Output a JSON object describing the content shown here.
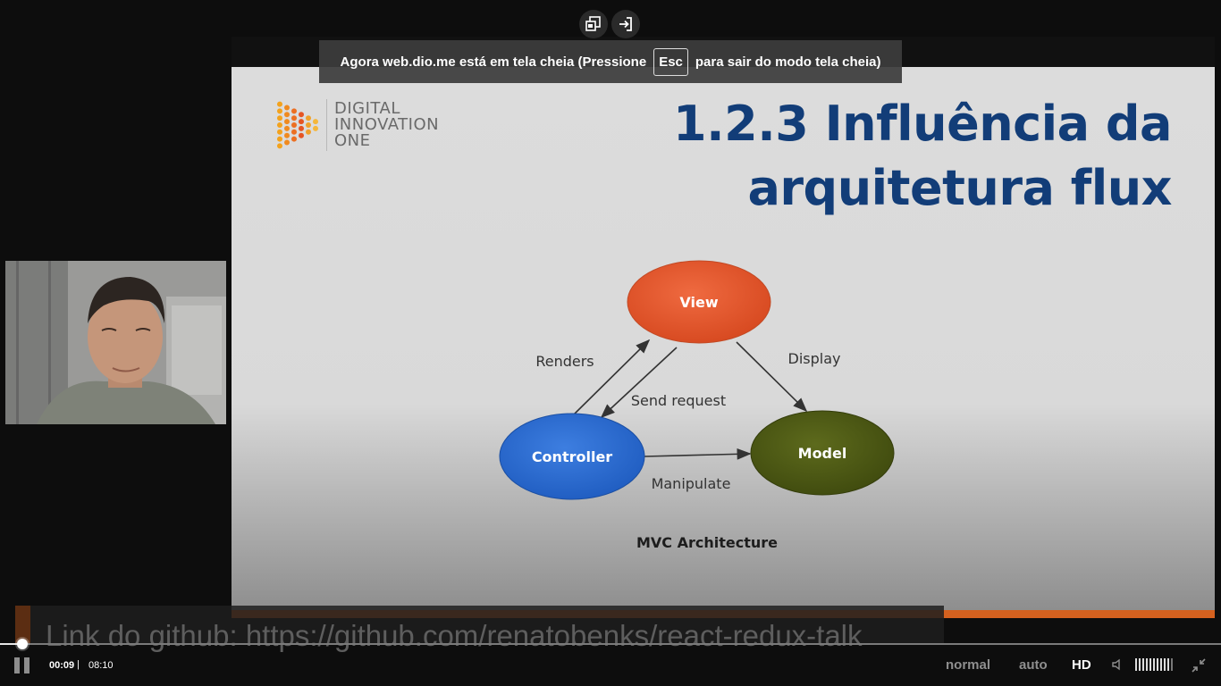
{
  "fullscreen_notice": {
    "before": "Agora web.dio.me está em tela cheia (Pressione",
    "key": "Esc",
    "after": "para sair do modo tela cheia)"
  },
  "top_controls": [
    {
      "icon": "picture-in-picture-icon"
    },
    {
      "icon": "exit-icon"
    }
  ],
  "slide": {
    "logo_lines": [
      "DIGITAL",
      "INNOVATION",
      "ONE"
    ],
    "title_line1": "1.2.3 Influência da",
    "title_line2": "arquitetura flux",
    "diagram": {
      "nodes": {
        "view": "View",
        "controller": "Controller",
        "model": "Model"
      },
      "edges": {
        "renders": "Renders",
        "send_request": "Send request",
        "display": "Display",
        "manipulate": "Manipulate"
      },
      "caption": "MVC Architecture"
    },
    "colors": {
      "title": "#123d78",
      "view": "#e0532c",
      "controller": "#2b6bd1",
      "model": "#4d5a14",
      "accent_bar": "#d5611f"
    }
  },
  "caption": {
    "text": "Link do github: https://github.com/renatobenks/react-redux-talk"
  },
  "player": {
    "current_time": "00:09",
    "separator": "|",
    "total_time": "08:10",
    "progress_fraction": 0.018,
    "speed_label": "normal",
    "quality_auto": "auto",
    "quality_hd": "HD",
    "volume_level": 0.9
  }
}
